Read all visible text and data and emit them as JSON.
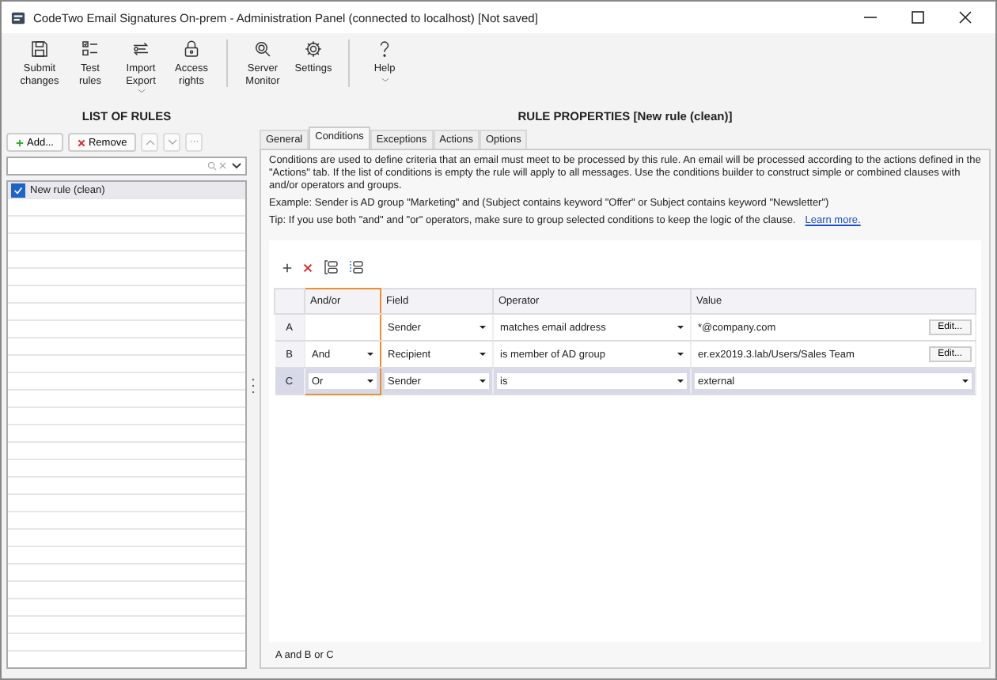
{
  "window": {
    "title": "CodeTwo Email Signatures On-prem - Administration Panel (connected to localhost) [Not saved]"
  },
  "toolbar": [
    {
      "kind": "save",
      "label_lines": [
        "Submit",
        "changes"
      ],
      "dropdown": false
    },
    {
      "kind": "list",
      "label_lines": [
        "Test",
        "rules"
      ],
      "dropdown": false
    },
    {
      "kind": "transfer",
      "label_lines": [
        "Import",
        "Export"
      ],
      "dropdown": true
    },
    {
      "kind": "lock",
      "label_lines": [
        "Access",
        "rights"
      ],
      "dropdown": false
    },
    {
      "kind": "monitor",
      "label_lines": [
        "Server",
        "Monitor"
      ],
      "dropdown": false
    },
    {
      "kind": "settings",
      "label_lines": [
        "Settings"
      ],
      "dropdown": false
    },
    {
      "kind": "help",
      "label_lines": [
        "Help"
      ],
      "dropdown": true
    }
  ],
  "rules_panel": {
    "title": "LIST OF RULES",
    "add_button": "Add...",
    "remove_button": "Remove",
    "more_button": "···",
    "rules": [
      {
        "name": "New rule (clean)",
        "checked": true,
        "selected": true
      }
    ]
  },
  "properties_panel": {
    "title": "RULE PROPERTIES [New rule (clean)]",
    "tabs": [
      {
        "label": "General",
        "selected": false
      },
      {
        "label": "Conditions",
        "selected": true
      },
      {
        "label": "Exceptions",
        "selected": false
      },
      {
        "label": "Actions",
        "selected": false
      },
      {
        "label": "Options",
        "selected": false
      }
    ],
    "description": "Conditions are used to define criteria that an email must meet to be processed by this rule. An email will be processed according to the actions defined in the \"Actions\" tab. If the list of conditions is empty the rule will apply to all messages. Use the conditions builder to construct simple or combined clauses with and/or operators and groups.",
    "example": "Example: Sender is AD group \"Marketing\" and (Subject contains keyword \"Offer\" or Subject contains keyword \"Newsletter\")",
    "tip": "Tip: If you use both \"and\" and \"or\" operators, make sure to group selected conditions to keep the logic of the clause.",
    "learn_more": "Learn more.",
    "columns": [
      {
        "label": "And/or",
        "highlighted": true
      },
      {
        "label": "Field",
        "highlighted": false
      },
      {
        "label": "Operator",
        "highlighted": false
      },
      {
        "label": "Value",
        "highlighted": false
      }
    ],
    "conditions": [
      {
        "letter": "A",
        "field": "Sender",
        "operator": "matches email address",
        "value": "*@company.com",
        "kind": "text",
        "edit_button": "Edit...",
        "selected": false
      },
      {
        "letter": "B",
        "and_or": "And",
        "field": "Recipient",
        "operator": "is member of AD group",
        "value": "er.ex2019.3.lab/Users/Sales Team",
        "kind": "text",
        "edit_button": "Edit...",
        "selected": false
      },
      {
        "letter": "C",
        "and_or": "Or",
        "field": "Sender",
        "operator": "is",
        "value": "external",
        "kind": "dropdown",
        "selected": true
      }
    ],
    "summary": "A and B or C"
  }
}
